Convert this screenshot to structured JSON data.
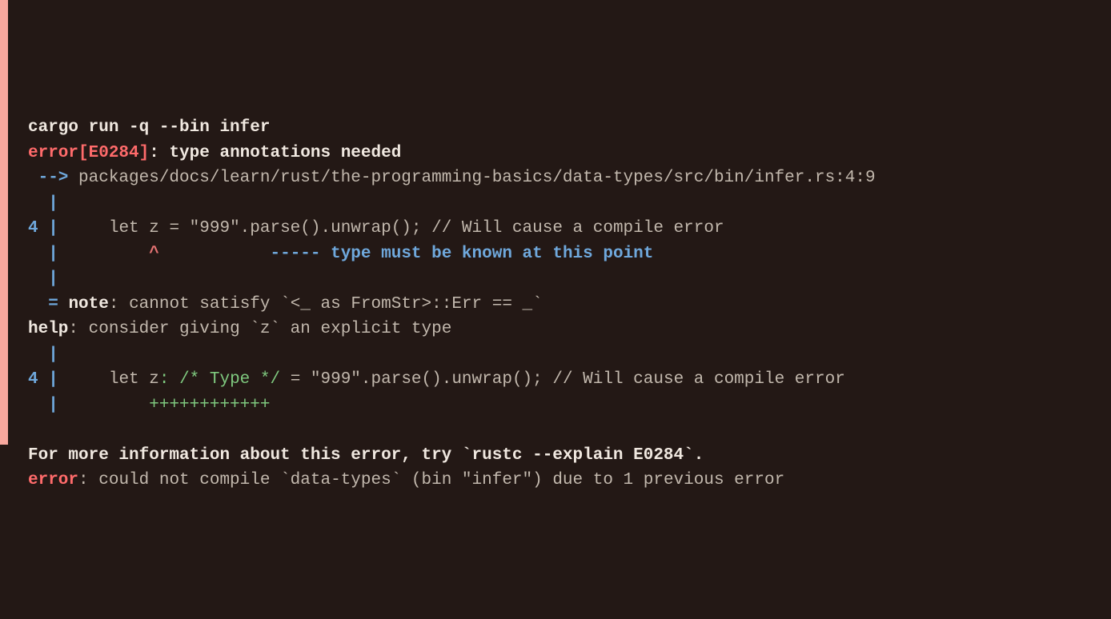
{
  "command": "cargo run -q --bin infer",
  "error_label": "error",
  "error_code": "[E0284]",
  "error_colon": ": ",
  "error_message": "type annotations needed",
  "arrow": " --> ",
  "file_path": "packages/docs/learn/rust/the-programming-basics/data-types/src/bin/infer.rs:4:9",
  "gutter_blank1": "  ",
  "pipe": "|",
  "line_number": "4",
  "code_line1_prefix": "     ",
  "code_line1": "let z = \"999\".parse().unwrap(); // Will cause a compile error",
  "caret_prefix": "         ",
  "caret": "^",
  "dash_prefix": "           ",
  "dashes": "-----",
  "note_inline": " type must be known at this point",
  "eq_prefix": "  ",
  "eq": "= ",
  "note_label": "note",
  "note_colon": ": ",
  "note_text": "cannot satisfy `<_ as FromStr>::Err == _`",
  "help_label": "help",
  "help_colon": ": ",
  "help_text": "consider giving `z` an explicit type",
  "code_line2_pre": "let z",
  "code_line2_insert": ": /* Type */",
  "code_line2_post": " = \"999\".parse().unwrap(); // Will cause a compile error",
  "plus_prefix": "         ",
  "pluses": "++++++++++++",
  "more_info": "For more information about this error, try `rustc --explain E0284`.",
  "final_err_label": "error",
  "final_err_colon": ": ",
  "final_err_text": "could not compile `data-types` (bin \"infer\") due to 1 previous error"
}
